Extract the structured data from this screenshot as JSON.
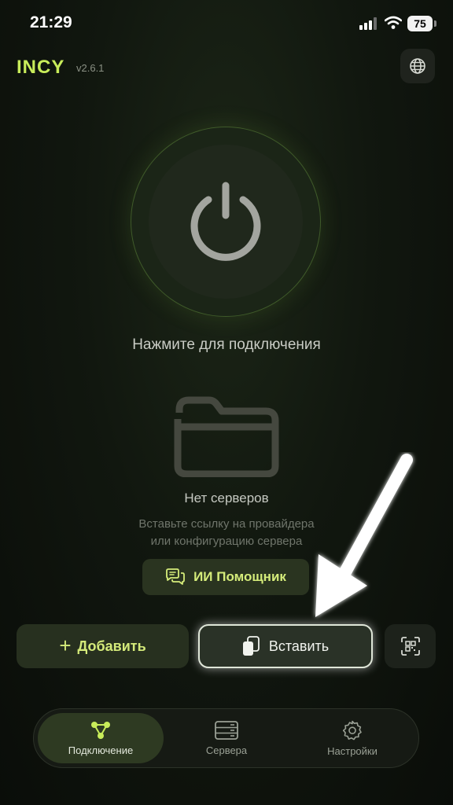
{
  "status_bar": {
    "time": "21:29",
    "battery": "75"
  },
  "header": {
    "app_name": "INCY",
    "version": "v2.6.1",
    "globe_icon": "globe-icon"
  },
  "power": {
    "icon": "power-icon",
    "hint": "Нажмите для подключения"
  },
  "empty_state": {
    "icon": "folder-icon",
    "title": "Нет серверов",
    "description_line1": "Вставьте ссылку на провайдера",
    "description_line2": "или конфигурацию сервера"
  },
  "ai_button": {
    "label": "ИИ Помощник",
    "icon": "chat-bubbles-icon"
  },
  "actions": {
    "add_label": "Добавить",
    "add_symbol": "+",
    "paste_label": "Вставить",
    "paste_icon": "clipboard-icon",
    "qr_icon": "qr-scan-icon"
  },
  "bottom_nav": {
    "items": [
      {
        "label": "Подключение",
        "icon": "network-nodes-icon",
        "active": true
      },
      {
        "label": "Сервера",
        "icon": "server-icon",
        "active": false
      },
      {
        "label": "Настройки",
        "icon": "gear-icon",
        "active": false
      }
    ]
  },
  "colors": {
    "accent": "#c8ec5a",
    "background": "#0b0f0a",
    "button_bg": "#27301f"
  }
}
